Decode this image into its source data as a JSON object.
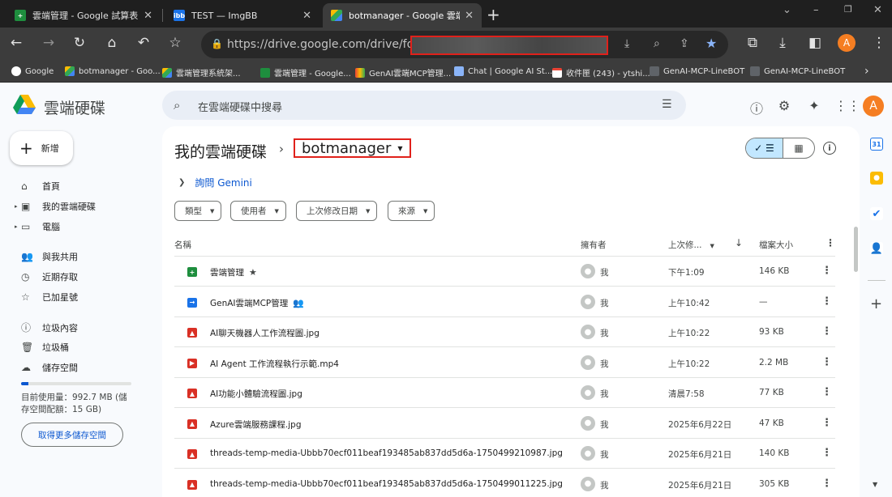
{
  "browser": {
    "tabs": [
      {
        "title": "雲端管理 - Google 試算表",
        "active": false
      },
      {
        "title": "TEST — ImgBB",
        "active": false
      },
      {
        "title": "botmanager - Google 雲端硬碟",
        "active": true
      }
    ],
    "url": "https://drive.google.com/drive/folders/",
    "bookmarks": [
      "Google",
      "botmanager - Goo...",
      "雲端管理系統架...",
      "雲端管理 - Google...",
      "GenAI雲端MCP管理...",
      "Chat | Google AI St...",
      "收件匣 (243) - ytshi...",
      "GenAI-MCP-LineBOT",
      "GenAI-MCP-LineBOT"
    ],
    "avatar_letter": "A"
  },
  "header": {
    "brand": "雲端硬碟",
    "search_placeholder": "在雲端硬碟中搜尋",
    "avatar_letter": "A"
  },
  "sidebar": {
    "new_label": "新增",
    "items": [
      {
        "label": "首頁",
        "icon": "home-icon",
        "caret": false
      },
      {
        "label": "我的雲端硬碟",
        "icon": "drive-icon",
        "caret": true
      },
      {
        "label": "電腦",
        "icon": "computer-icon",
        "caret": true
      },
      {
        "label": "與我共用",
        "icon": "people-icon",
        "caret": false
      },
      {
        "label": "近期存取",
        "icon": "clock-icon",
        "caret": false
      },
      {
        "label": "已加星號",
        "icon": "star-icon",
        "caret": false
      },
      {
        "label": "垃圾內容",
        "icon": "spam-icon",
        "caret": false
      },
      {
        "label": "垃圾桶",
        "icon": "trash-icon",
        "caret": false
      },
      {
        "label": "儲存空間",
        "icon": "cloud-icon",
        "caret": false
      }
    ],
    "storage_text": "目前使用量：992.7 MB (儲存空間配額：15 GB)",
    "storage_used_fraction": 0.065,
    "storage_button": "取得更多儲存空間"
  },
  "main": {
    "breadcrumb_root": "我的雲端硬碟",
    "breadcrumb_current": "botmanager",
    "gemini_label": "詢問 Gemini",
    "filters": [
      "類型",
      "使用者",
      "上次修改日期",
      "來源"
    ],
    "columns": {
      "name": "名稱",
      "owner": "擁有者",
      "modified": "上次修...",
      "size": "檔案大小"
    },
    "files": [
      {
        "name": "雲端管理",
        "type": "sheet",
        "mark": "★",
        "owner": "我",
        "modified": "下午1:09",
        "size": "146 KB"
      },
      {
        "name": "GenAI雲端MCP管理",
        "type": "shortcut",
        "mark": "👥",
        "owner": "我",
        "modified": "上午10:42",
        "size": "—"
      },
      {
        "name": "AI聊天機器人工作流程圖.jpg",
        "type": "image",
        "mark": "",
        "owner": "我",
        "modified": "上午10:22",
        "size": "93 KB"
      },
      {
        "name": "AI Agent 工作流程執行示範.mp4",
        "type": "video",
        "mark": "",
        "owner": "我",
        "modified": "上午10:22",
        "size": "2.2 MB"
      },
      {
        "name": "AI功能小體驗流程圖.jpg",
        "type": "image",
        "mark": "",
        "owner": "我",
        "modified": "清晨7:58",
        "size": "77 KB"
      },
      {
        "name": "Azure雲端服務課程.jpg",
        "type": "image",
        "mark": "",
        "owner": "我",
        "modified": "2025年6月22日",
        "size": "47 KB"
      },
      {
        "name": "threads-temp-media-Ubbb70ecf011beaf193485ab837dd5d6a-1750499210987.jpg",
        "type": "image",
        "mark": "",
        "owner": "我",
        "modified": "2025年6月21日",
        "size": "140 KB"
      },
      {
        "name": "threads-temp-media-Ubbb70ecf011beaf193485ab837dd5d6a-1750499011225.jpg",
        "type": "image",
        "mark": "",
        "owner": "我",
        "modified": "2025年6月21日",
        "size": "305 KB"
      }
    ]
  },
  "colors": {
    "accent": "#0b57d0",
    "sheet": "#1e8e3e",
    "shortcut": "#1a73e8",
    "image": "#d93025",
    "video": "#d93025",
    "highlight": "#e0211b"
  }
}
